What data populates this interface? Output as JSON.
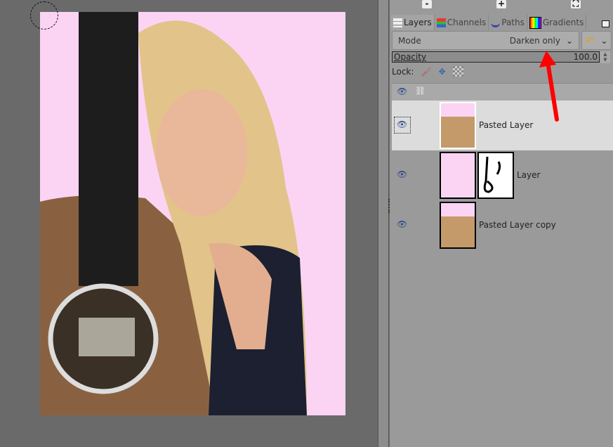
{
  "toolbar": {
    "buttons": [
      {
        "icon": "minus-icon",
        "label": "-"
      },
      {
        "icon": "plus-icon",
        "label": "+"
      },
      {
        "icon": "fit-icon",
        "label": "⛶"
      }
    ]
  },
  "tabs": [
    {
      "label": "Layers",
      "icon": "layers-icon",
      "active": true
    },
    {
      "label": "Channels",
      "icon": "channels-icon"
    },
    {
      "label": "Paths",
      "icon": "paths-icon"
    },
    {
      "label": "Gradients",
      "icon": "gradients-icon"
    }
  ],
  "mode": {
    "label": "Mode",
    "value": "Darken only"
  },
  "opacity": {
    "label": "Opacity",
    "value": "100.0"
  },
  "lock": {
    "label": "Lock:"
  },
  "layers": [
    {
      "name": "Pasted Layer",
      "selected": true
    },
    {
      "name": "Layer",
      "has_mask": true
    },
    {
      "name": "Pasted Layer copy"
    }
  ],
  "colors": {
    "canvas_bg": "#6a6a6a",
    "photo_bg": "#fbd4f4",
    "arrow": "#ff0000",
    "panel_bg": "#9a9a9a"
  }
}
